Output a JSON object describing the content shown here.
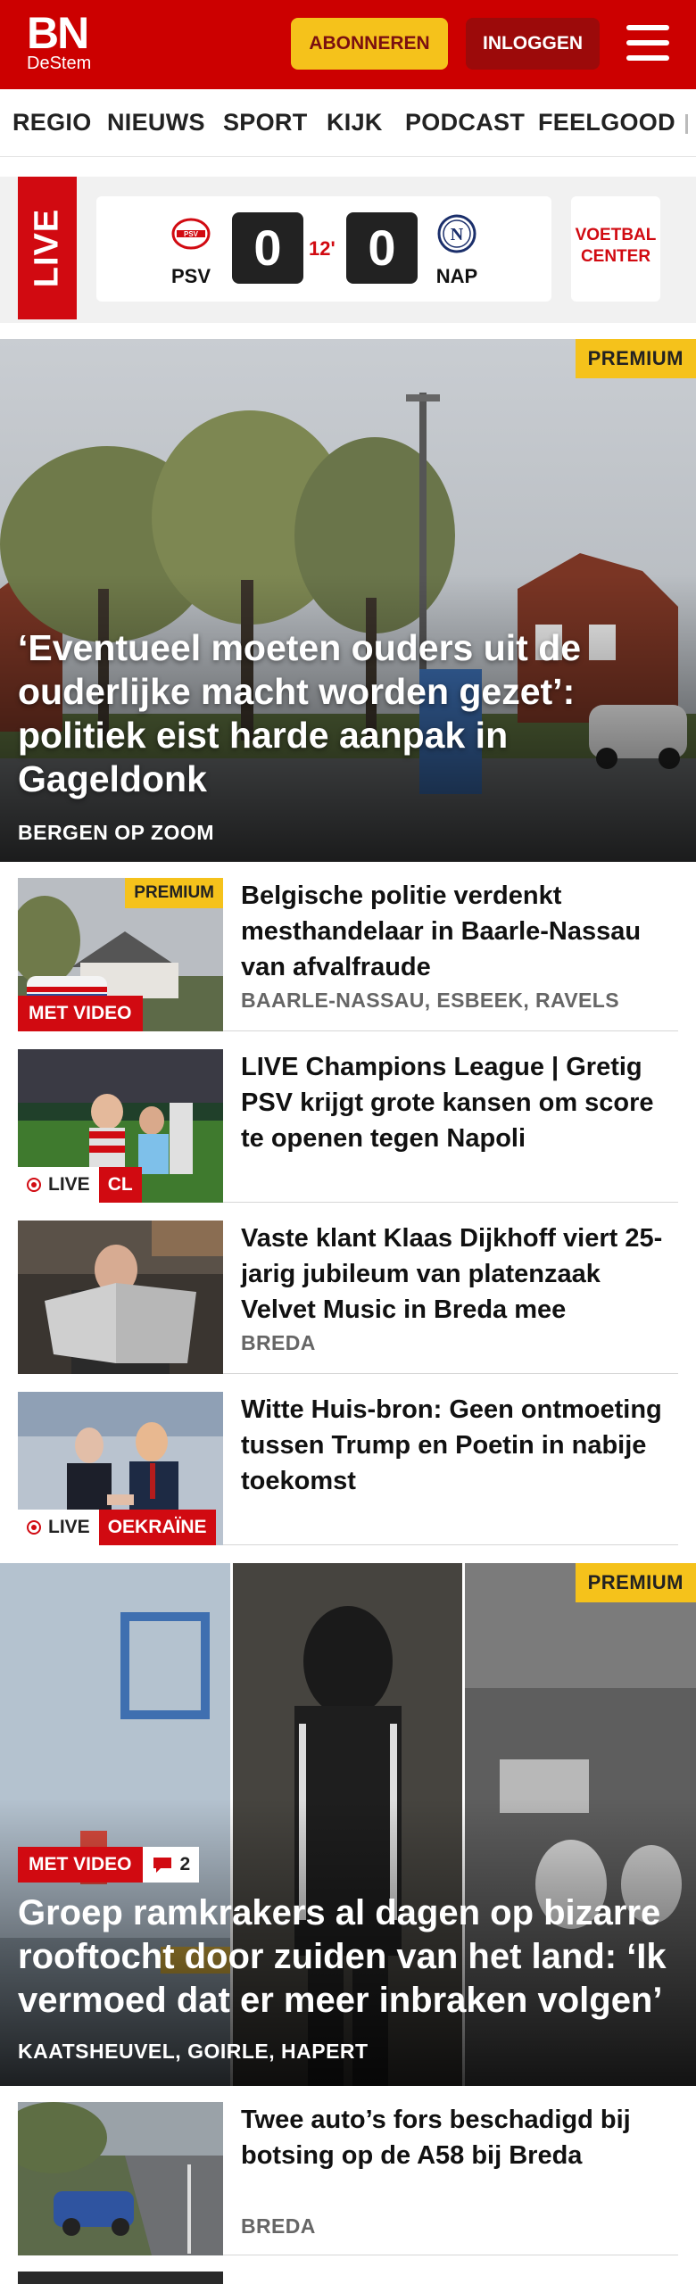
{
  "header": {
    "logo_main": "BN",
    "logo_sub": "DeStem",
    "subscribe_label": "ABONNEREN",
    "login_label": "INLOGGEN",
    "brand_color": "#cc0000"
  },
  "nav": {
    "items": [
      "REGIO",
      "NIEUWS",
      "SPORT",
      "KIJK",
      "PODCAST",
      "FEELGOOD"
    ]
  },
  "live": {
    "label": "LIVE",
    "home_team": "PSV",
    "away_team": "NAP",
    "home_score": "0",
    "away_score": "0",
    "minute": "12'",
    "voetbal_line1": "VOETBAL",
    "voetbal_line2": "CENTER"
  },
  "hero": {
    "badge": "PREMIUM",
    "title": "‘Eventueel moeten ouders uit de ouderlijke macht worden gezet’: politiek eist harde aanpak in Gageldonk",
    "tag": "BERGEN OP ZOOM"
  },
  "articles": [
    {
      "title": "Belgische politie verdenkt mesthandelaar in Baarle-Nassau van afvalfraude",
      "tag": "BAARLE-NASSAU, ESBEEK, RAVELS",
      "badge": "PREMIUM",
      "video_label": "MET VIDEO"
    },
    {
      "title": "LIVE Champions League | Gretig PSV krijgt grote kansen om score te openen tegen Napoli",
      "live_label": "LIVE",
      "category": "CL"
    },
    {
      "title": "Vaste klant Klaas Dijkhoff viert 25-jarig jubileum van platenzaak Velvet Music in Breda mee",
      "tag": "BREDA"
    },
    {
      "title": "Witte Huis-bron: Geen ontmoeting tussen Trump en Poetin in nabije toekomst",
      "live_label": "LIVE",
      "category": "OEKRAÏNE"
    }
  ],
  "hero2": {
    "badge": "PREMIUM",
    "video_label": "MET VIDEO",
    "comments": "2",
    "title": "Groep ramkrakers al dagen op bizarre rooftocht door zuiden van het land: ‘Ik vermoed dat er meer inbraken volgen’",
    "tag": "KAATSHEUVEL, GOIRLE, HAPERT"
  },
  "article5": {
    "title": "Twee auto’s fors beschadigd bij botsing op de A58 bij Breda",
    "tag": "BREDA"
  }
}
